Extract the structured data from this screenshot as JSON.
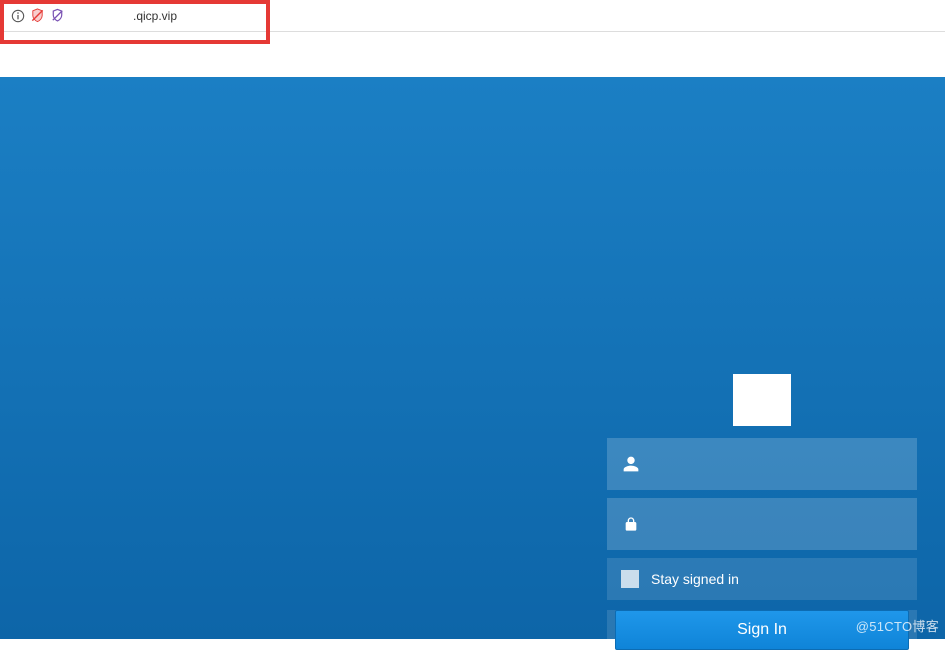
{
  "browser": {
    "url_display": ".qicp.vip",
    "icons": {
      "info": "info-icon",
      "shield": "shield-slash-icon",
      "tracking": "tracking-protection-icon"
    },
    "highlight_color": "#e53935"
  },
  "login": {
    "username_value": "",
    "username_placeholder": "",
    "password_value": "",
    "password_placeholder": "",
    "stay_signed_in_label": "Stay signed in",
    "stay_signed_in_checked": false,
    "signin_button_label": "Sign In",
    "logo_bg": "#ffffff"
  },
  "colors": {
    "panel_gradient_top": "#1b7fc4",
    "panel_gradient_bottom": "#0d65a8",
    "button_gradient_top": "#1f97ea",
    "button_gradient_bottom": "#0f84d8",
    "input_bg": "rgba(255,255,255,0.18)"
  },
  "watermark": "@51CTO博客"
}
